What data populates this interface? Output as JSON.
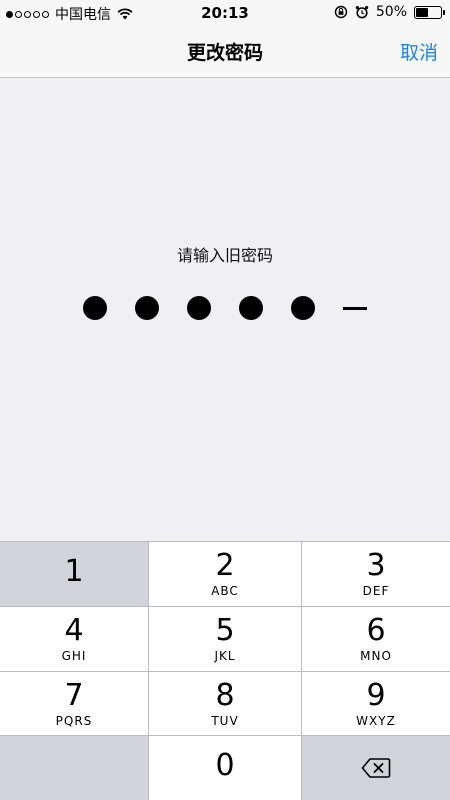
{
  "status_bar": {
    "carrier": "中国电信",
    "time": "20:13",
    "battery": "50%",
    "battery_level": 0.5,
    "signal_bars_filled": 1,
    "signal_bars_total": 5
  },
  "nav": {
    "title": "更改密码",
    "cancel_label": "取消"
  },
  "prompt": "请输入旧密码",
  "passcode": {
    "entered": 5,
    "length": 6
  },
  "keypad": {
    "keys": [
      {
        "digit": "1",
        "letters": ""
      },
      {
        "digit": "2",
        "letters": "ABC"
      },
      {
        "digit": "3",
        "letters": "DEF"
      },
      {
        "digit": "4",
        "letters": "GHI"
      },
      {
        "digit": "5",
        "letters": "JKL"
      },
      {
        "digit": "6",
        "letters": "MNO"
      },
      {
        "digit": "7",
        "letters": "PQRS"
      },
      {
        "digit": "8",
        "letters": "TUV"
      },
      {
        "digit": "9",
        "letters": "WXYZ"
      },
      {
        "digit": "0",
        "letters": ""
      }
    ],
    "backspace_icon": "backspace-icon"
  },
  "colors": {
    "accent": "#1a82fb",
    "background": "#efeff4",
    "key_dark": "#d1d4da"
  }
}
